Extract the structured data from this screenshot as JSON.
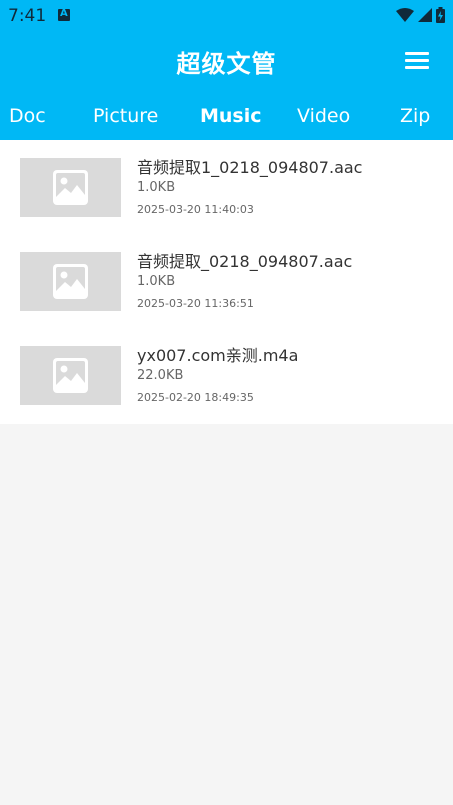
{
  "status_bar": {
    "time": "7:41"
  },
  "app_bar": {
    "title": "超级文管",
    "menu_icon": "hamburger-menu-icon"
  },
  "tabs": [
    {
      "label": "Doc",
      "active": false
    },
    {
      "label": "Picture",
      "active": false
    },
    {
      "label": "Music",
      "active": true
    },
    {
      "label": "Video",
      "active": false
    },
    {
      "label": "Zip",
      "active": false
    }
  ],
  "files": [
    {
      "name": "音频提取1_0218_094807.aac",
      "size": "1.0KB",
      "date": "2025-03-20 11:40:03",
      "thumbnail_icon": "image-placeholder-icon"
    },
    {
      "name": "音频提取_0218_094807.aac",
      "size": "1.0KB",
      "date": "2025-03-20 11:36:51",
      "thumbnail_icon": "image-placeholder-icon"
    },
    {
      "name": "yx007.com亲测.m4a",
      "size": "22.0KB",
      "date": "2025-02-20 18:49:35",
      "thumbnail_icon": "image-placeholder-icon"
    }
  ],
  "colors": {
    "primary": "#00b8f5",
    "list_background": "#ffffff",
    "page_background": "#f5f5f5",
    "thumbnail_background": "#dadada",
    "text_primary": "#333333",
    "text_secondary": "#666666"
  }
}
